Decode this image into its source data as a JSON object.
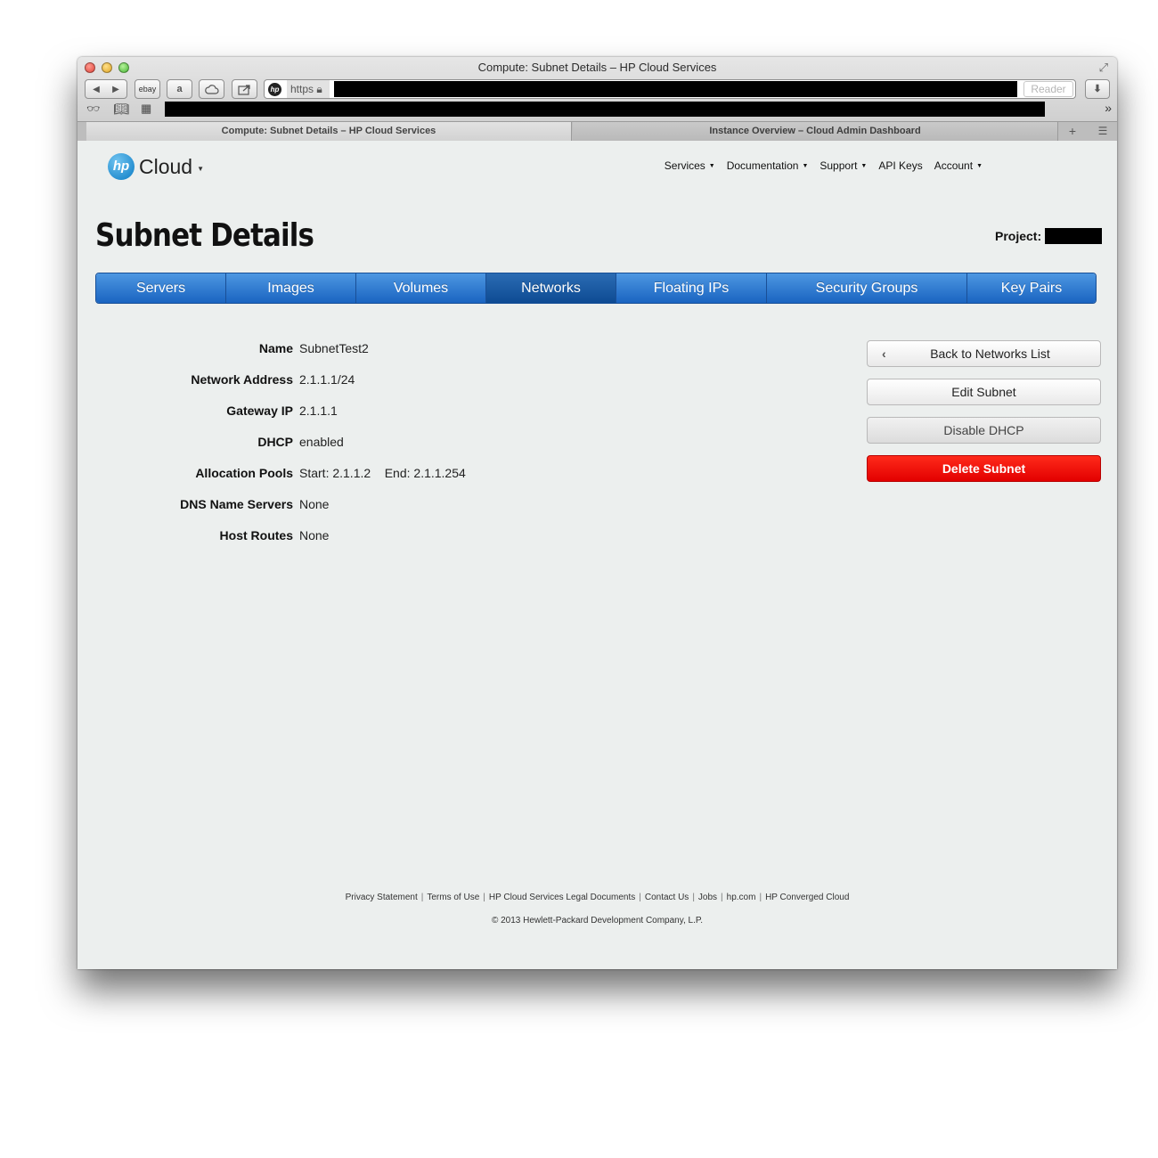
{
  "browser": {
    "window_title": "Compute: Subnet Details – HP Cloud Services",
    "toolbar": {
      "back": "◀",
      "forward": "▶",
      "ebay": "ebay",
      "amazon": "a",
      "url_scheme": "https",
      "reader": "Reader"
    },
    "tabs": [
      {
        "label": "Compute: Subnet Details – HP Cloud Services",
        "active": true
      },
      {
        "label": "Instance Overview – Cloud Admin Dashboard",
        "active": false
      }
    ],
    "icons": [
      "fullscreen-icon",
      "cloud-icon",
      "share-icon",
      "lock-icon",
      "download-icon",
      "reading-list-icon",
      "bookmarks-icon",
      "top-sites-icon",
      "new-tab-icon",
      "tab-view-icon"
    ]
  },
  "header": {
    "logo_mark": "hp",
    "logo_text": "Cloud",
    "nav": [
      {
        "label": "Services",
        "dropdown": true
      },
      {
        "label": "Documentation",
        "dropdown": true
      },
      {
        "label": "Support",
        "dropdown": true
      },
      {
        "label": "API Keys",
        "dropdown": false
      },
      {
        "label": "Account",
        "dropdown": true
      }
    ]
  },
  "page": {
    "title": "Subnet Details",
    "project_label": "Project:"
  },
  "tabs": [
    {
      "label": "Servers",
      "active": false
    },
    {
      "label": "Images",
      "active": false
    },
    {
      "label": "Volumes",
      "active": false
    },
    {
      "label": "Networks",
      "active": true
    },
    {
      "label": "Floating IPs",
      "active": false
    },
    {
      "label": "Security Groups",
      "active": false
    },
    {
      "label": "Key Pairs",
      "active": false
    }
  ],
  "details": [
    {
      "label": "Name",
      "value": "SubnetTest2"
    },
    {
      "label": "Network Address",
      "value": "2.1.1.1/24"
    },
    {
      "label": "Gateway IP",
      "value": "2.1.1.1"
    },
    {
      "label": "DHCP",
      "value": "enabled"
    },
    {
      "label": "Allocation Pools",
      "value": "Start: 2.1.1.2    End: 2.1.1.254"
    },
    {
      "label": "DNS Name Servers",
      "value": "None"
    },
    {
      "label": "Host Routes",
      "value": "None"
    }
  ],
  "actions": {
    "back": "Back to Networks List",
    "edit": "Edit Subnet",
    "disable_dhcp": "Disable DHCP",
    "delete": "Delete Subnet"
  },
  "colors": {
    "tab_blue": "#1a64c1",
    "tab_active": "#0d4a93",
    "delete_red": "#ff1a0a"
  },
  "footer": {
    "links": [
      "Privacy Statement",
      "Terms of Use",
      "HP Cloud Services Legal Documents",
      "Contact Us",
      "Jobs",
      "hp.com",
      "HP Converged Cloud"
    ],
    "copyright": "© 2013 Hewlett-Packard Development Company, L.P."
  }
}
